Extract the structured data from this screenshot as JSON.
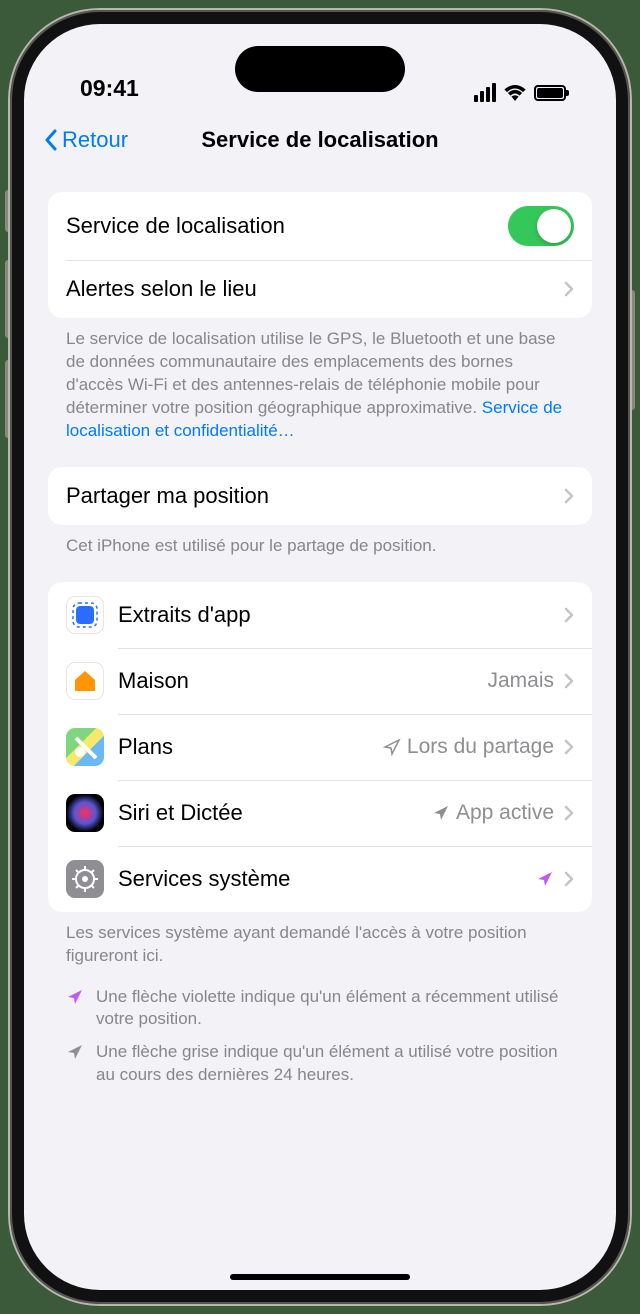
{
  "status": {
    "time": "09:41"
  },
  "nav": {
    "back": "Retour",
    "title": "Service de localisation"
  },
  "section1": {
    "toggle_label": "Service de localisation",
    "alerts_label": "Alertes selon le lieu",
    "footer": "Le service de localisation utilise le GPS, le Bluetooth et une base de données communautaire des emplacements des bornes d'accès Wi-Fi et des antennes-relais de téléphonie mobile pour déterminer votre position géographique approximative. ",
    "footer_link": "Service de localisation et confidentialité…"
  },
  "section2": {
    "share_label": "Partager ma position",
    "footer": "Cet iPhone est utilisé pour le partage de position."
  },
  "apps": {
    "appclips": {
      "label": "Extraits d'app"
    },
    "home": {
      "label": "Maison",
      "value": "Jamais"
    },
    "maps": {
      "label": "Plans",
      "value": "Lors du partage"
    },
    "siri": {
      "label": "Siri et Dictée",
      "value": "App active"
    },
    "system": {
      "label": "Services système"
    }
  },
  "apps_footer": "Les services système ayant demandé l'accès à votre position figureront ici.",
  "legend": {
    "purple": "Une flèche violette indique qu'un élément a récemment utilisé votre position.",
    "gray": "Une flèche grise indique qu'un élément a utilisé votre position au cours des dernières 24 heures."
  }
}
